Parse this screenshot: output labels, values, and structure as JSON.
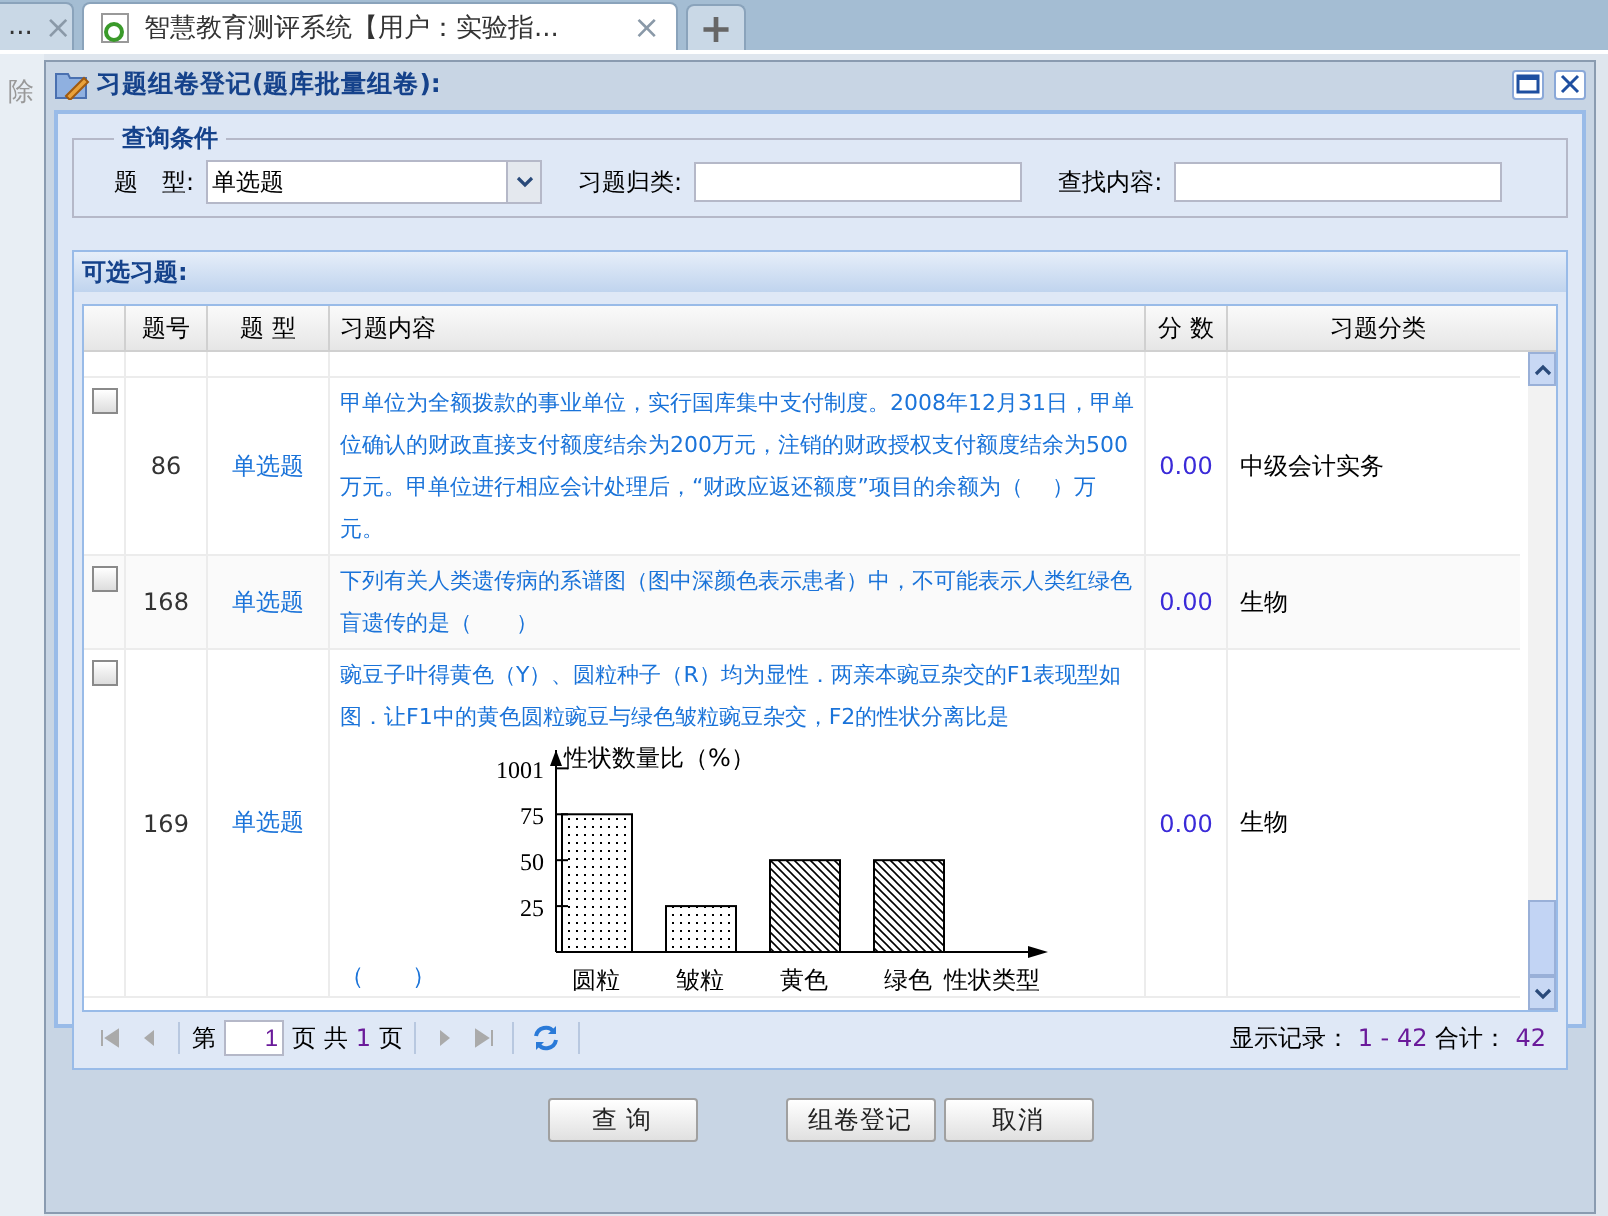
{
  "browser_tabs": [
    {
      "title": "...",
      "close": "×",
      "selected": false
    },
    {
      "title": "智慧教育测评系统【用户：实验指...",
      "close": "×",
      "selected": true
    }
  ],
  "new_tab": "+",
  "background_app": {
    "toolbar_text": "除"
  },
  "dialog": {
    "title": "习题组卷登记(题库批量组卷):"
  },
  "query": {
    "legend": "查询条件",
    "fields": [
      {
        "label": "题　型:",
        "kind": "select",
        "value": "单选题"
      },
      {
        "label": "习题归类:",
        "kind": "text"
      },
      {
        "label": "查找内容:",
        "kind": "text"
      }
    ]
  },
  "grid": {
    "title": "可选习题:",
    "columns": [
      "题号",
      "题 型",
      "习题内容",
      "分 数",
      "习题分类"
    ],
    "rows": [
      {
        "checked": false,
        "number": "86",
        "type": "单选题",
        "content": "甲单位为全额拨款的事业单位，实行国库集中支付制度。2008年12月31日，甲单位确认的财政直接支付额度结余为200万元，注销的财政授权支付额度结余为500万元。甲单位进行相应会计处理后，“财政应返还额度”项目的余额为（　 ）万元。",
        "score": "0.00",
        "category": "中级会计实务"
      },
      {
        "checked": false,
        "number": "168",
        "type": "单选题",
        "content": "下列有关人类遗传病的系谱图（图中深颜色表示患者）中，不可能表示人类红绿色盲遗传的是（　　）",
        "score": "0.00",
        "category": "生物"
      },
      {
        "checked": false,
        "number": "169",
        "type": "单选题",
        "content": "豌豆子叶得黄色（Y）、圆粒种子（R）均为显性．两亲本豌豆杂交的F1表现型如图．让F1中的黄色圆粒豌豆与绿色皱粒豌豆杂交，F2的性状分离比是",
        "answer_blank": "（　　）",
        "score": "0.00",
        "category": "生物",
        "chart_data": {
          "type": "bar",
          "ylabel": "性状数量比（%）",
          "xlabel": "性状类型",
          "categories": [
            "圆粒",
            "皱粒",
            "黄色",
            "绿色"
          ],
          "values": [
            75,
            25,
            50,
            50
          ],
          "yticks": [
            25,
            50,
            75
          ],
          "ylim": [
            0,
            110
          ],
          "annotations": [
            "1001"
          ]
        }
      }
    ]
  },
  "pager": {
    "page_prefix": "第",
    "page": "1",
    "page_mid": "页 共",
    "total_pages": "1",
    "page_suffix": "页",
    "records_label": "显示记录：",
    "records_range": "1 - 42",
    "total_label": "合计：",
    "total": "42"
  },
  "buttons": [
    "查 询",
    "组卷登记",
    "取消"
  ]
}
